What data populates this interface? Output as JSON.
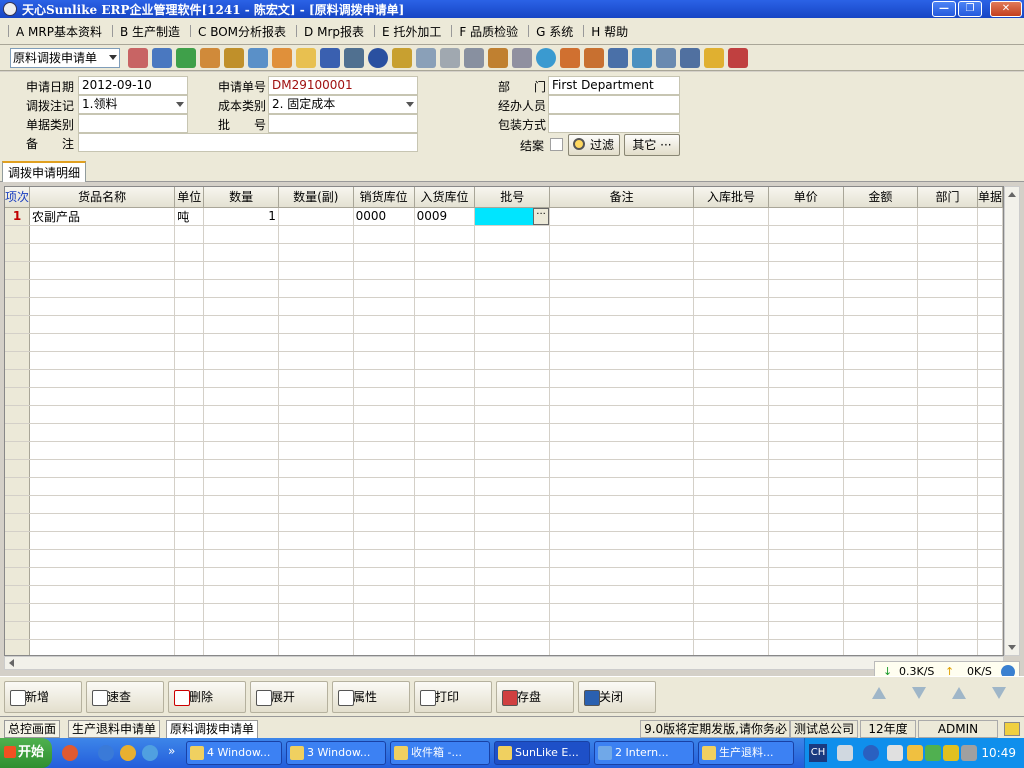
{
  "window": {
    "title": "天心Sunlike ERP企业管理软件[1241 - 陈宏文] - [原料调拨申请单]"
  },
  "menu": [
    "A MRP基本资料",
    "B 生产制造",
    "C BOM分析报表",
    "D Mrp报表",
    "E 托外加工",
    "F 品质检验",
    "G 系统",
    "H 帮助"
  ],
  "toolbar": {
    "doc_type": "原料调拨申请单"
  },
  "form": {
    "apply_date_label": "申请日期",
    "apply_date": "2012-09-10",
    "apply_no_label": "申请单号",
    "apply_no": "DM29100001",
    "dept_label": "部　　门",
    "dept": "First Department",
    "transfer_label": "调拨注记",
    "transfer": "1.领料",
    "cost_type_label": "成本类别",
    "cost_type": "2. 固定成本",
    "handler_label": "经办人员",
    "handler": "",
    "doc_cat_label": "单据类别",
    "doc_cat": "",
    "batch_label": "批　　号",
    "batch": "",
    "pack_label": "包装方式",
    "pack": "",
    "remark_label": "备　　注",
    "remark": "",
    "close_label": "结案",
    "filter_btn": "过滤",
    "other_btn": "其它 ···"
  },
  "tab": {
    "label": "调拨申请明细"
  },
  "grid": {
    "columns": [
      "项次",
      "货品名称",
      "单位",
      "数量",
      "数量(副)",
      "销货库位",
      "入货库位",
      "批号",
      "备注",
      "入库批号",
      "单价",
      "金额",
      "部门",
      "单据"
    ],
    "rows": [
      {
        "no": "1",
        "name": "农副产品",
        "unit": "吨",
        "qty": "1",
        "qty2": "",
        "out_loc": "0000",
        "in_loc": "0009",
        "batch": "",
        "remark": "",
        "in_batch": "",
        "price": "",
        "amount": "",
        "dept": "",
        "doc": ""
      }
    ],
    "ellipsis": "···"
  },
  "netmon": {
    "down": "0.3K/S",
    "up": "0K/S"
  },
  "actions": [
    "新增",
    "速查",
    "删除",
    "展开",
    "属性",
    "打印",
    "存盘",
    "关闭"
  ],
  "status": {
    "tabs": [
      "总控画面",
      "生产退料申请单",
      "原料调拨申请单"
    ],
    "notice": "9.0版将定期发版,请你务必",
    "company": "测试总公司",
    "year": "12年度",
    "user": "ADMIN"
  },
  "taskbar": {
    "start": "开始",
    "items": [
      "4 Window...",
      "3 Window...",
      "收件箱 -...",
      "SunLike E...",
      "2 Intern...",
      "生产退料..."
    ],
    "lang": "CH",
    "clock": "10:49"
  }
}
